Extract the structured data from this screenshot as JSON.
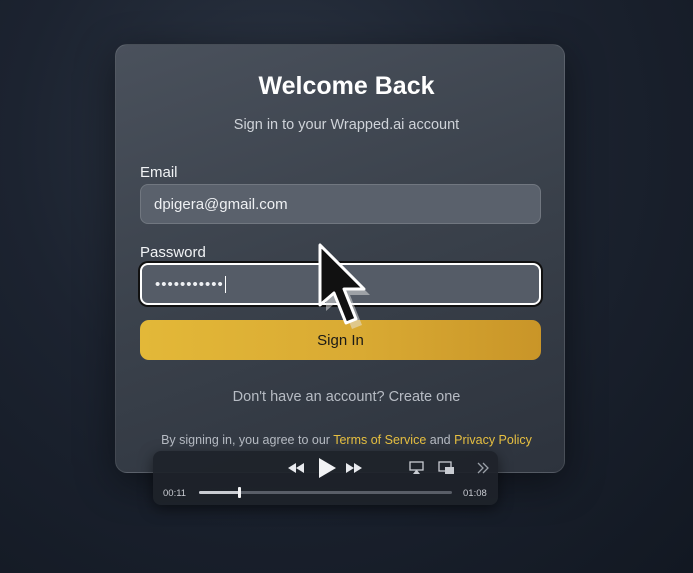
{
  "login": {
    "title": "Welcome Back",
    "subtitle": "Sign in to your Wrapped.ai account",
    "email_label": "Email",
    "email_value": "dpigera@gmail.com",
    "password_label": "Password",
    "password_masked": "•••••••••••",
    "signin_label": "Sign In",
    "create_account": "Don't have an account? Create one",
    "terms_prefix": "By signing in, you agree to our ",
    "terms_link": "Terms of Service",
    "terms_and": " and ",
    "privacy_link": "Privacy Policy"
  },
  "player": {
    "current_time": "00:11",
    "total_time": "01:08",
    "progress": 0.16,
    "icons": [
      "rewind-icon",
      "play-icon",
      "fast-forward-icon",
      "airplay-icon",
      "picture-in-picture-icon",
      "chevron-double-right-icon"
    ]
  },
  "colors": {
    "accent": "#e3b838",
    "link": "#e7c041",
    "card": "#3a414b",
    "background": "#1c2330"
  },
  "cursor": {
    "icon": "pointer-arrow-icon"
  }
}
